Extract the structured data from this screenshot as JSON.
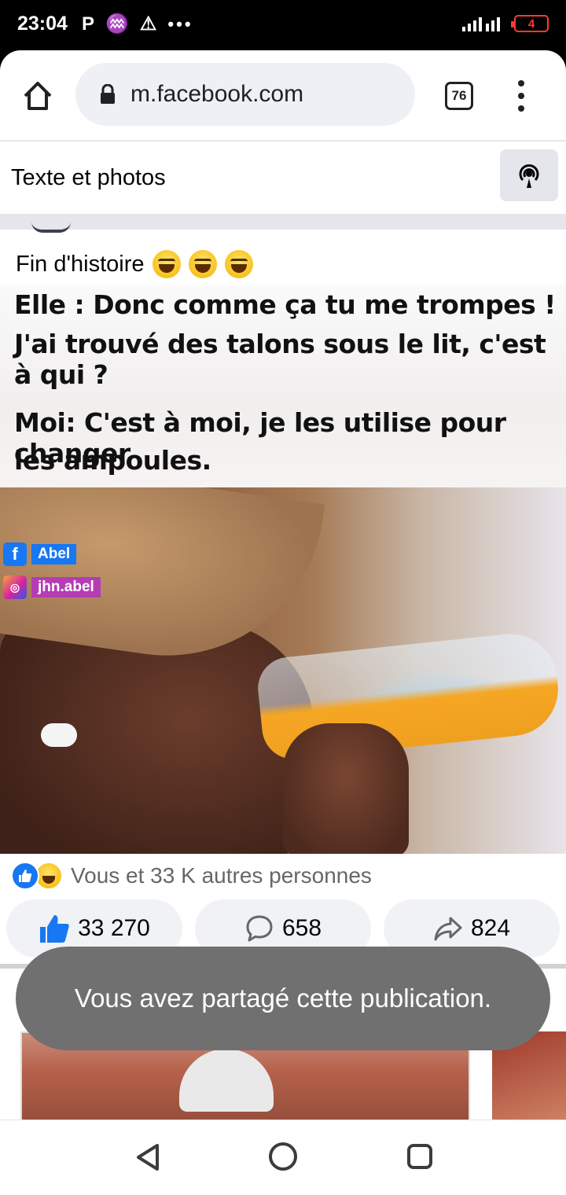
{
  "status_bar": {
    "time": "23:04",
    "left_icons": [
      "P",
      "♒",
      "⚠"
    ],
    "overflow": "•••",
    "battery_level": "4",
    "battery_color": "#ff3b30"
  },
  "browser": {
    "url": "m.facebook.com",
    "tab_count": "76"
  },
  "subheader": {
    "title": "Texte et photos"
  },
  "post": {
    "caption": "Fin d'histoire",
    "caption_emojis": [
      "laughing-emoji",
      "laughing-emoji",
      "tears-of-joy-emoji"
    ],
    "meme_lines": [
      "Elle : Donc comme ça tu me trompes !",
      "J'ai trouvé des talons sous le lit, c'est à qui ?",
      "Moi: C'est à moi, je les utilise pour changer",
      "les ampoules."
    ],
    "watermarks": {
      "facebook": "Abel",
      "instagram": "jhn.abel"
    },
    "reactions_text": "Vous et 33 K autres personnes",
    "like_count": "33 270",
    "comment_count": "658",
    "share_count": "824",
    "accent_color": "#1877f2"
  },
  "toast": {
    "message": "Vous avez partagé cette publication."
  }
}
